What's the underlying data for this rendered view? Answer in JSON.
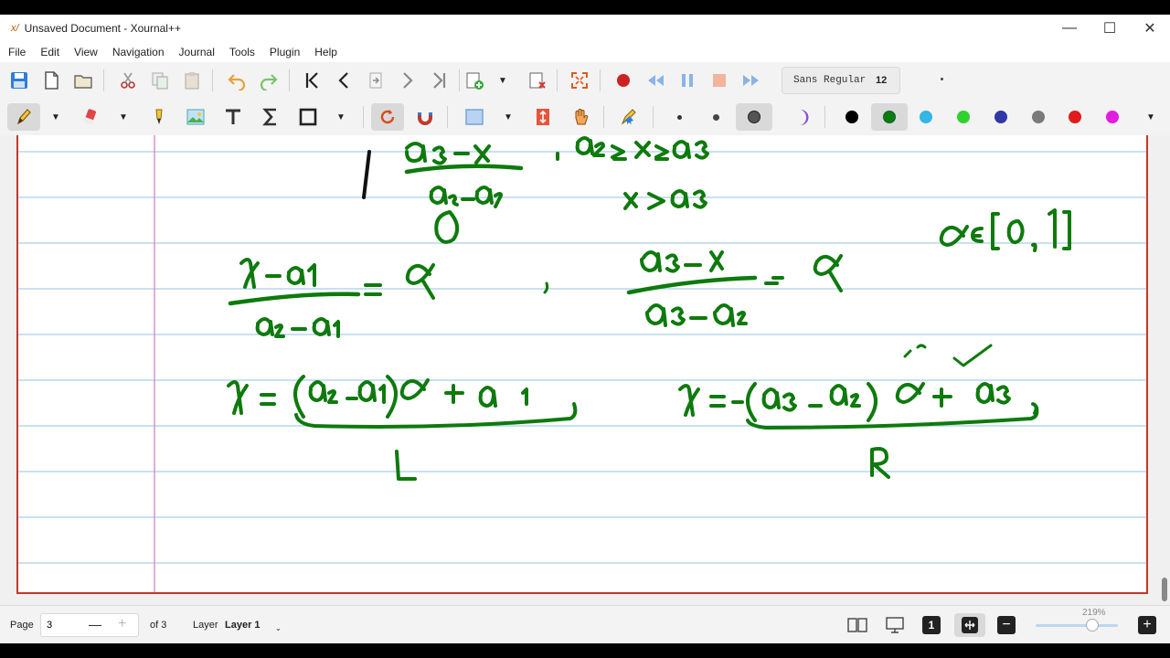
{
  "window": {
    "logo": "x/",
    "title": "Unsaved Document - Xournal++",
    "minimize": "—",
    "maximize": "☐",
    "close": "✕"
  },
  "menu": [
    "File",
    "Edit",
    "View",
    "Navigation",
    "Journal",
    "Tools",
    "Plugin",
    "Help"
  ],
  "toolbar": {
    "font_name": "Sans Regular",
    "font_size": "12",
    "pen_colors": [
      "#000000",
      "#0e7a0d",
      "#33b5e5",
      "#2ed12e",
      "#3037a8",
      "#7a7a7a",
      "#e01b1b",
      "#e21ce2"
    ],
    "active_color": "#0e7a0d"
  },
  "status": {
    "page_label": "Page",
    "page_value": "3",
    "of_pages": "of 3",
    "layer_label": "Layer",
    "layer_value": "Layer 1",
    "zoom": "219%"
  },
  "page_style": {
    "rule_color": "#a9cdea",
    "margin_color": "#d98cc4",
    "ink_color": "#0e7a0d"
  },
  "ink_notes": [
    "a3-x",
    "a3-a2",
    "a2≤x≤a3",
    "x>a3",
    "0",
    "α ∈ [0,1]",
    "x-a1",
    "a2-a1",
    "=α",
    "a3-x",
    "a3-a2",
    "=α",
    "x = (a2-a1)α + a1",
    "L",
    "x = -(a3-a2)α + a3",
    "R"
  ]
}
